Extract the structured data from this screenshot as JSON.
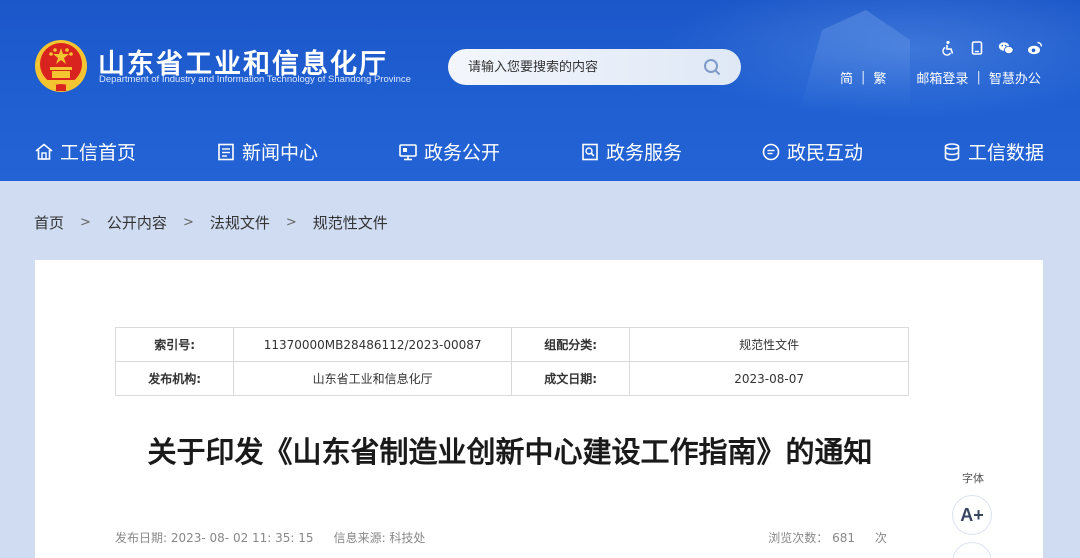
{
  "header": {
    "site_title": "山东省工业和信息化厅",
    "site_subtitle": "Department of Industry and Information Technology of Shandong Province",
    "search_placeholder": "请输入您要搜索的内容",
    "icons": [
      "accessibility-icon",
      "mobile-icon",
      "wechat-icon",
      "weibo-icon"
    ],
    "links": {
      "simplified": "简",
      "traditional": "繁",
      "mail_login": "邮箱登录",
      "smart_office": "智慧办公"
    },
    "colors": {
      "primary": "#1f5fd2",
      "emblem_red": "#d8231f",
      "emblem_gold": "#f5c531"
    }
  },
  "nav": [
    {
      "label": "工信首页",
      "icon": "home-icon"
    },
    {
      "label": "新闻中心",
      "icon": "news-icon"
    },
    {
      "label": "政务公开",
      "icon": "monitor-icon"
    },
    {
      "label": "政务服务",
      "icon": "service-icon"
    },
    {
      "label": "政民互动",
      "icon": "chat-icon"
    },
    {
      "label": "工信数据",
      "icon": "database-icon"
    }
  ],
  "breadcrumb": {
    "items": [
      "首页",
      "公开内容",
      "法规文件",
      "规范性文件"
    ],
    "separator": ">"
  },
  "meta": {
    "index_label": "索引号:",
    "index_value": "11370000MB28486112/2023-00087",
    "category_label": "组配分类:",
    "category_value": "规范性文件",
    "publisher_label": "发布机构:",
    "publisher_value": "山东省工业和信息化厅",
    "date_label": "成文日期:",
    "date_value": "2023-08-07"
  },
  "document": {
    "title": "关于印发《山东省制造业创新中心建设工作指南》的通知",
    "publish_date": "发布日期: 2023- 08- 02 11: 35: 15",
    "source": "信息来源: 科技处",
    "views_label": "浏览次数：  681",
    "views_unit": "次"
  },
  "font_tool": {
    "label": "字体",
    "increase_label": "A+"
  }
}
